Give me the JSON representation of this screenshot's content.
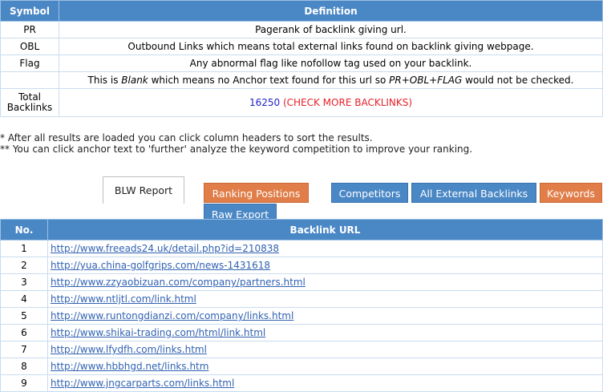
{
  "legend": {
    "headers": {
      "symbol": "Symbol",
      "definition": "Definition"
    },
    "rows": [
      {
        "symbol": "PR",
        "definition": "Pagerank of backlink giving url."
      },
      {
        "symbol": "OBL",
        "definition": "Outbound Links which means total external links found on backlink giving webpage."
      },
      {
        "symbol": "Flag",
        "definition": "Any abnormal flag like nofollow tag used on your backlink."
      },
      {
        "symbol": "",
        "pre": "This is ",
        "em1": "Blank",
        "mid": " which means no Anchor text found for this url so ",
        "em2": "PR+OBL+FLAG",
        "post": " would not be checked."
      }
    ],
    "total": {
      "label_line1": "Total",
      "label_line2": "Backlinks",
      "count": "16250",
      "link": "(CHECK MORE BACKLINKS)"
    }
  },
  "notes": {
    "line1": "* After all results are loaded you can click column headers to sort the results.",
    "line2": "** You can click anchor text to 'further' analyze the keyword competition to improve your ranking."
  },
  "tabs": {
    "blw_report": "BLW Report",
    "ranking_positions": "Ranking Positions",
    "competitors": "Competitors",
    "all_external_backlinks": "All External Backlinks",
    "keywords": "Keywords",
    "raw_export": "Raw Export"
  },
  "results": {
    "headers": {
      "no": "No.",
      "url": "Backlink URL"
    },
    "rows": [
      {
        "no": "1",
        "url": "http://www.freeads24.uk/detail.php?id=210838"
      },
      {
        "no": "2",
        "url": "http://yua.china-golfgrips.com/news-1431618"
      },
      {
        "no": "3",
        "url": "http://www.zzyaobizuan.com/company/partners.html"
      },
      {
        "no": "4",
        "url": "http://www.ntljtl.com/link.html"
      },
      {
        "no": "5",
        "url": "http://www.runtongdianzi.com/company/links.html"
      },
      {
        "no": "6",
        "url": "http://www.shikai-trading.com/html/link.html"
      },
      {
        "no": "7",
        "url": "http://www.lfydfh.com/links.html"
      },
      {
        "no": "8",
        "url": "http://www.hbbhgd.net/links.htm"
      },
      {
        "no": "9",
        "url": "http://www.jngcarparts.com/links.html"
      }
    ]
  },
  "colors": {
    "header_blue": "#4a87c5",
    "tab_orange": "#e07d48",
    "link_blue": "#3162b3",
    "alert_red": "#e8202a",
    "count_blue": "#1e1ec8"
  }
}
